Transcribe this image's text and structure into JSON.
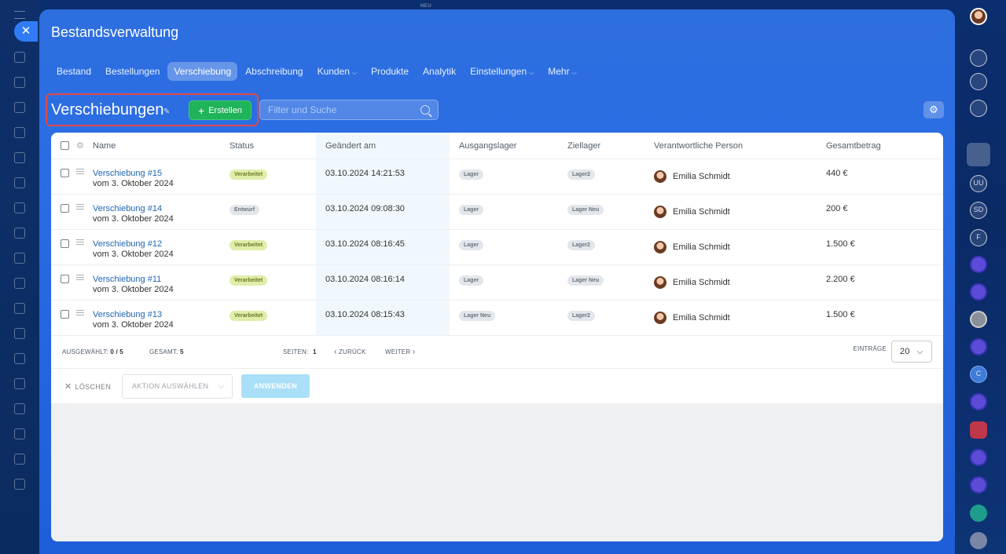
{
  "top_label": "NEU",
  "app": {
    "title": "Bestandsverwaltung",
    "close_symbol": "✕"
  },
  "tabs": [
    {
      "label": "Bestand",
      "active": false,
      "dropdown": false
    },
    {
      "label": "Bestellungen",
      "active": false,
      "dropdown": false
    },
    {
      "label": "Verschiebung",
      "active": true,
      "dropdown": false
    },
    {
      "label": "Abschreibung",
      "active": false,
      "dropdown": false
    },
    {
      "label": "Kunden",
      "active": false,
      "dropdown": true
    },
    {
      "label": "Produkte",
      "active": false,
      "dropdown": false
    },
    {
      "label": "Analytik",
      "active": false,
      "dropdown": false
    },
    {
      "label": "Einstellungen",
      "active": false,
      "dropdown": true
    },
    {
      "label": "Mehr",
      "active": false,
      "dropdown": true
    }
  ],
  "toolbar": {
    "page_title": "Verschiebungen",
    "create_label": "Erstellen",
    "search_placeholder": "Filter und Suche"
  },
  "table": {
    "columns": [
      "Name",
      "Status",
      "Geändert am",
      "Ausgangslager",
      "Ziellager",
      "Verantwortliche Person",
      "Gesamtbetrag"
    ],
    "rows": [
      {
        "name": "Verschiebung #15",
        "sub": "vom 3. Oktober 2024",
        "status": "Verarbeitet",
        "status_kind": "done",
        "date": "03.10.2024 14:21:53",
        "from": "Lager",
        "to": "Lager2",
        "person": "Emilia Schmidt",
        "total": "440 €"
      },
      {
        "name": "Verschiebung #14",
        "sub": "vom 3. Oktober 2024",
        "status": "Entwurf",
        "status_kind": "draft",
        "date": "03.10.2024 09:08:30",
        "from": "Lager",
        "to": "Lager Neu",
        "person": "Emilia Schmidt",
        "total": "200 €"
      },
      {
        "name": "Verschiebung #12",
        "sub": "vom 3. Oktober 2024",
        "status": "Verarbeitet",
        "status_kind": "done",
        "date": "03.10.2024 08:16:45",
        "from": "Lager",
        "to": "Lager2",
        "person": "Emilia Schmidt",
        "total": "1.500 €"
      },
      {
        "name": "Verschiebung #11",
        "sub": "vom 3. Oktober 2024",
        "status": "Verarbeitet",
        "status_kind": "done",
        "date": "03.10.2024 08:16:14",
        "from": "Lager",
        "to": "Lager Neu",
        "person": "Emilia Schmidt",
        "total": "2.200 €"
      },
      {
        "name": "Verschiebung #13",
        "sub": "vom 3. Oktober 2024",
        "status": "Verarbeitet",
        "status_kind": "done",
        "date": "03.10.2024 08:15:43",
        "from": "Lager Neu",
        "to": "Lager2",
        "person": "Emilia Schmidt",
        "total": "1.500 €"
      }
    ]
  },
  "footer": {
    "selected_label": "AUSGEWÄHLT:",
    "selected_value": "0 / 5",
    "total_label": "GESAMT:",
    "total_value": "5",
    "pages_label": "SEITEN:",
    "pages_value": "1",
    "back_label": "ZURÜCK",
    "next_label": "WEITER",
    "per_page_label": "EINTRÄGE",
    "per_page_value": "20"
  },
  "actions": {
    "delete_label": "LÖSCHEN",
    "select_placeholder": "AKTION AUSWÄHLEN",
    "apply_label": "ANWENDEN"
  },
  "right_rail": {
    "initials_uu": "UU",
    "initials_sd": "SD",
    "initials_f": "F",
    "initials_c": "C"
  },
  "colors": {
    "accent_blue": "#2f7cf6",
    "create_green": "#1fb35a",
    "highlight_red": "#e34848",
    "link_blue": "#2066b0"
  }
}
